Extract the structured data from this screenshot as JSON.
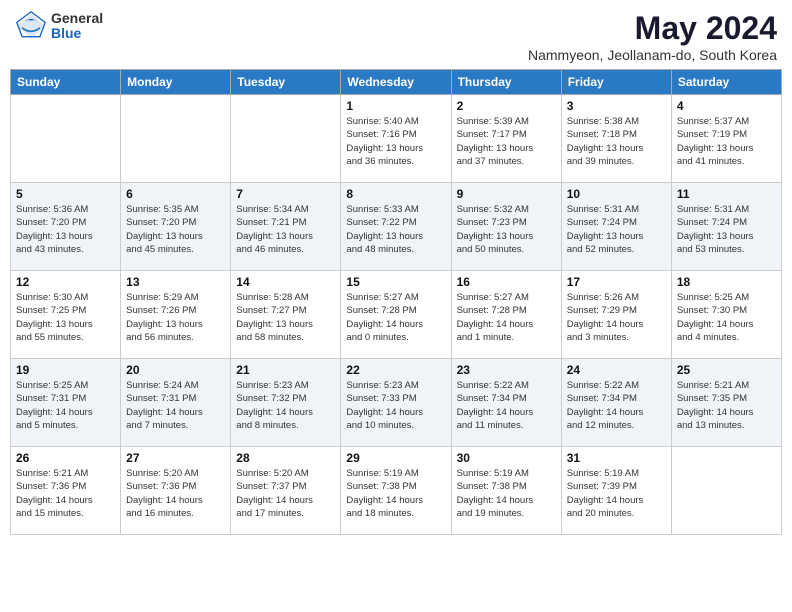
{
  "logo": {
    "general": "General",
    "blue": "Blue"
  },
  "title": {
    "month": "May 2024",
    "location": "Nammyeon, Jeollanam-do, South Korea"
  },
  "weekdays": [
    "Sunday",
    "Monday",
    "Tuesday",
    "Wednesday",
    "Thursday",
    "Friday",
    "Saturday"
  ],
  "weeks": [
    [
      {
        "day": "",
        "info": ""
      },
      {
        "day": "",
        "info": ""
      },
      {
        "day": "",
        "info": ""
      },
      {
        "day": "1",
        "info": "Sunrise: 5:40 AM\nSunset: 7:16 PM\nDaylight: 13 hours\nand 36 minutes."
      },
      {
        "day": "2",
        "info": "Sunrise: 5:39 AM\nSunset: 7:17 PM\nDaylight: 13 hours\nand 37 minutes."
      },
      {
        "day": "3",
        "info": "Sunrise: 5:38 AM\nSunset: 7:18 PM\nDaylight: 13 hours\nand 39 minutes."
      },
      {
        "day": "4",
        "info": "Sunrise: 5:37 AM\nSunset: 7:19 PM\nDaylight: 13 hours\nand 41 minutes."
      }
    ],
    [
      {
        "day": "5",
        "info": "Sunrise: 5:36 AM\nSunset: 7:20 PM\nDaylight: 13 hours\nand 43 minutes."
      },
      {
        "day": "6",
        "info": "Sunrise: 5:35 AM\nSunset: 7:20 PM\nDaylight: 13 hours\nand 45 minutes."
      },
      {
        "day": "7",
        "info": "Sunrise: 5:34 AM\nSunset: 7:21 PM\nDaylight: 13 hours\nand 46 minutes."
      },
      {
        "day": "8",
        "info": "Sunrise: 5:33 AM\nSunset: 7:22 PM\nDaylight: 13 hours\nand 48 minutes."
      },
      {
        "day": "9",
        "info": "Sunrise: 5:32 AM\nSunset: 7:23 PM\nDaylight: 13 hours\nand 50 minutes."
      },
      {
        "day": "10",
        "info": "Sunrise: 5:31 AM\nSunset: 7:24 PM\nDaylight: 13 hours\nand 52 minutes."
      },
      {
        "day": "11",
        "info": "Sunrise: 5:31 AM\nSunset: 7:24 PM\nDaylight: 13 hours\nand 53 minutes."
      }
    ],
    [
      {
        "day": "12",
        "info": "Sunrise: 5:30 AM\nSunset: 7:25 PM\nDaylight: 13 hours\nand 55 minutes."
      },
      {
        "day": "13",
        "info": "Sunrise: 5:29 AM\nSunset: 7:26 PM\nDaylight: 13 hours\nand 56 minutes."
      },
      {
        "day": "14",
        "info": "Sunrise: 5:28 AM\nSunset: 7:27 PM\nDaylight: 13 hours\nand 58 minutes."
      },
      {
        "day": "15",
        "info": "Sunrise: 5:27 AM\nSunset: 7:28 PM\nDaylight: 14 hours\nand 0 minutes."
      },
      {
        "day": "16",
        "info": "Sunrise: 5:27 AM\nSunset: 7:28 PM\nDaylight: 14 hours\nand 1 minute."
      },
      {
        "day": "17",
        "info": "Sunrise: 5:26 AM\nSunset: 7:29 PM\nDaylight: 14 hours\nand 3 minutes."
      },
      {
        "day": "18",
        "info": "Sunrise: 5:25 AM\nSunset: 7:30 PM\nDaylight: 14 hours\nand 4 minutes."
      }
    ],
    [
      {
        "day": "19",
        "info": "Sunrise: 5:25 AM\nSunset: 7:31 PM\nDaylight: 14 hours\nand 5 minutes."
      },
      {
        "day": "20",
        "info": "Sunrise: 5:24 AM\nSunset: 7:31 PM\nDaylight: 14 hours\nand 7 minutes."
      },
      {
        "day": "21",
        "info": "Sunrise: 5:23 AM\nSunset: 7:32 PM\nDaylight: 14 hours\nand 8 minutes."
      },
      {
        "day": "22",
        "info": "Sunrise: 5:23 AM\nSunset: 7:33 PM\nDaylight: 14 hours\nand 10 minutes."
      },
      {
        "day": "23",
        "info": "Sunrise: 5:22 AM\nSunset: 7:34 PM\nDaylight: 14 hours\nand 11 minutes."
      },
      {
        "day": "24",
        "info": "Sunrise: 5:22 AM\nSunset: 7:34 PM\nDaylight: 14 hours\nand 12 minutes."
      },
      {
        "day": "25",
        "info": "Sunrise: 5:21 AM\nSunset: 7:35 PM\nDaylight: 14 hours\nand 13 minutes."
      }
    ],
    [
      {
        "day": "26",
        "info": "Sunrise: 5:21 AM\nSunset: 7:36 PM\nDaylight: 14 hours\nand 15 minutes."
      },
      {
        "day": "27",
        "info": "Sunrise: 5:20 AM\nSunset: 7:36 PM\nDaylight: 14 hours\nand 16 minutes."
      },
      {
        "day": "28",
        "info": "Sunrise: 5:20 AM\nSunset: 7:37 PM\nDaylight: 14 hours\nand 17 minutes."
      },
      {
        "day": "29",
        "info": "Sunrise: 5:19 AM\nSunset: 7:38 PM\nDaylight: 14 hours\nand 18 minutes."
      },
      {
        "day": "30",
        "info": "Sunrise: 5:19 AM\nSunset: 7:38 PM\nDaylight: 14 hours\nand 19 minutes."
      },
      {
        "day": "31",
        "info": "Sunrise: 5:19 AM\nSunset: 7:39 PM\nDaylight: 14 hours\nand 20 minutes."
      },
      {
        "day": "",
        "info": ""
      }
    ]
  ]
}
